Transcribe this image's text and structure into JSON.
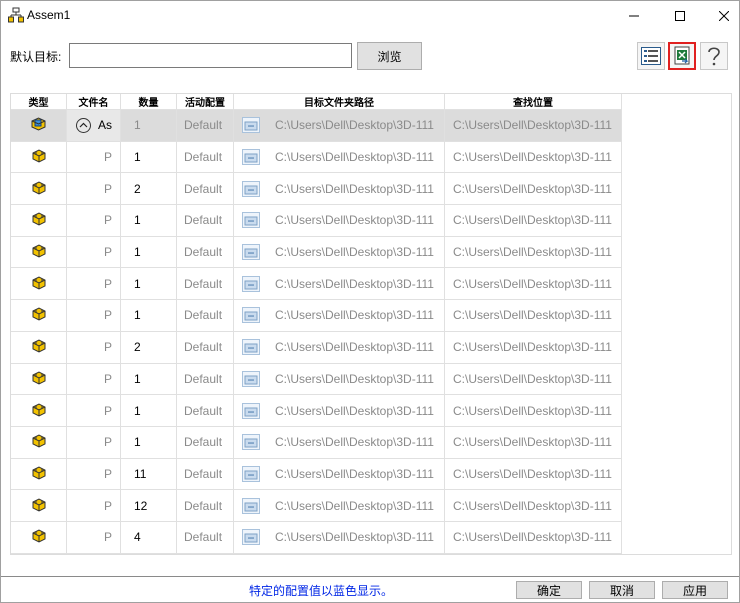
{
  "window": {
    "title": "Assem1"
  },
  "target": {
    "label": "默认目标:",
    "value": "",
    "browse_label": "浏览"
  },
  "grid": {
    "headers": [
      "类型",
      "文件名",
      "数量",
      "活动配置",
      "目标文件夹路径",
      "查找位置"
    ],
    "rows": [
      {
        "type_icon": "assembly-icon",
        "name": "As",
        "qty": "1",
        "config": "Default",
        "target": "C:\\Users\\Dell\\Desktop\\3D-111",
        "find": "C:\\Users\\Dell\\Desktop\\3D-111",
        "selected": true
      },
      {
        "type_icon": "part-icon",
        "name": "P",
        "qty": "1",
        "config": "Default",
        "target": "C:\\Users\\Dell\\Desktop\\3D-111",
        "find": "C:\\Users\\Dell\\Desktop\\3D-111"
      },
      {
        "type_icon": "part-icon",
        "name": "P",
        "qty": "2",
        "config": "Default",
        "target": "C:\\Users\\Dell\\Desktop\\3D-111",
        "find": "C:\\Users\\Dell\\Desktop\\3D-111"
      },
      {
        "type_icon": "part-icon",
        "name": "P",
        "qty": "1",
        "config": "Default",
        "target": "C:\\Users\\Dell\\Desktop\\3D-111",
        "find": "C:\\Users\\Dell\\Desktop\\3D-111"
      },
      {
        "type_icon": "part-icon",
        "name": "P",
        "qty": "1",
        "config": "Default",
        "target": "C:\\Users\\Dell\\Desktop\\3D-111",
        "find": "C:\\Users\\Dell\\Desktop\\3D-111"
      },
      {
        "type_icon": "part-icon",
        "name": "P",
        "qty": "1",
        "config": "Default",
        "target": "C:\\Users\\Dell\\Desktop\\3D-111",
        "find": "C:\\Users\\Dell\\Desktop\\3D-111"
      },
      {
        "type_icon": "part-icon",
        "name": "P",
        "qty": "1",
        "config": "Default",
        "target": "C:\\Users\\Dell\\Desktop\\3D-111",
        "find": "C:\\Users\\Dell\\Desktop\\3D-111"
      },
      {
        "type_icon": "part-icon",
        "name": "P",
        "qty": "2",
        "config": "Default",
        "target": "C:\\Users\\Dell\\Desktop\\3D-111",
        "find": "C:\\Users\\Dell\\Desktop\\3D-111"
      },
      {
        "type_icon": "part-icon",
        "name": "P",
        "qty": "1",
        "config": "Default",
        "target": "C:\\Users\\Dell\\Desktop\\3D-111",
        "find": "C:\\Users\\Dell\\Desktop\\3D-111"
      },
      {
        "type_icon": "part-icon",
        "name": "P",
        "qty": "1",
        "config": "Default",
        "target": "C:\\Users\\Dell\\Desktop\\3D-111",
        "find": "C:\\Users\\Dell\\Desktop\\3D-111"
      },
      {
        "type_icon": "part-icon",
        "name": "P",
        "qty": "1",
        "config": "Default",
        "target": "C:\\Users\\Dell\\Desktop\\3D-111",
        "find": "C:\\Users\\Dell\\Desktop\\3D-111"
      },
      {
        "type_icon": "part-icon",
        "name": "P",
        "qty": "11",
        "config": "Default",
        "target": "C:\\Users\\Dell\\Desktop\\3D-111",
        "find": "C:\\Users\\Dell\\Desktop\\3D-111"
      },
      {
        "type_icon": "part-icon",
        "name": "P",
        "qty": "12",
        "config": "Default",
        "target": "C:\\Users\\Dell\\Desktop\\3D-111",
        "find": "C:\\Users\\Dell\\Desktop\\3D-111"
      },
      {
        "type_icon": "part-icon",
        "name": "P",
        "qty": "4",
        "config": "Default",
        "target": "C:\\Users\\Dell\\Desktop\\3D-111",
        "find": "C:\\Users\\Dell\\Desktop\\3D-111"
      }
    ]
  },
  "footer": {
    "note": "特定的配置值以蓝色显示。",
    "note_color": "#0026e6",
    "ok_label": "确定",
    "cancel_label": "取消",
    "apply_label": "应用"
  },
  "colors": {
    "highlight_border": "#e02020",
    "selected_row": "#dcdcdc"
  }
}
